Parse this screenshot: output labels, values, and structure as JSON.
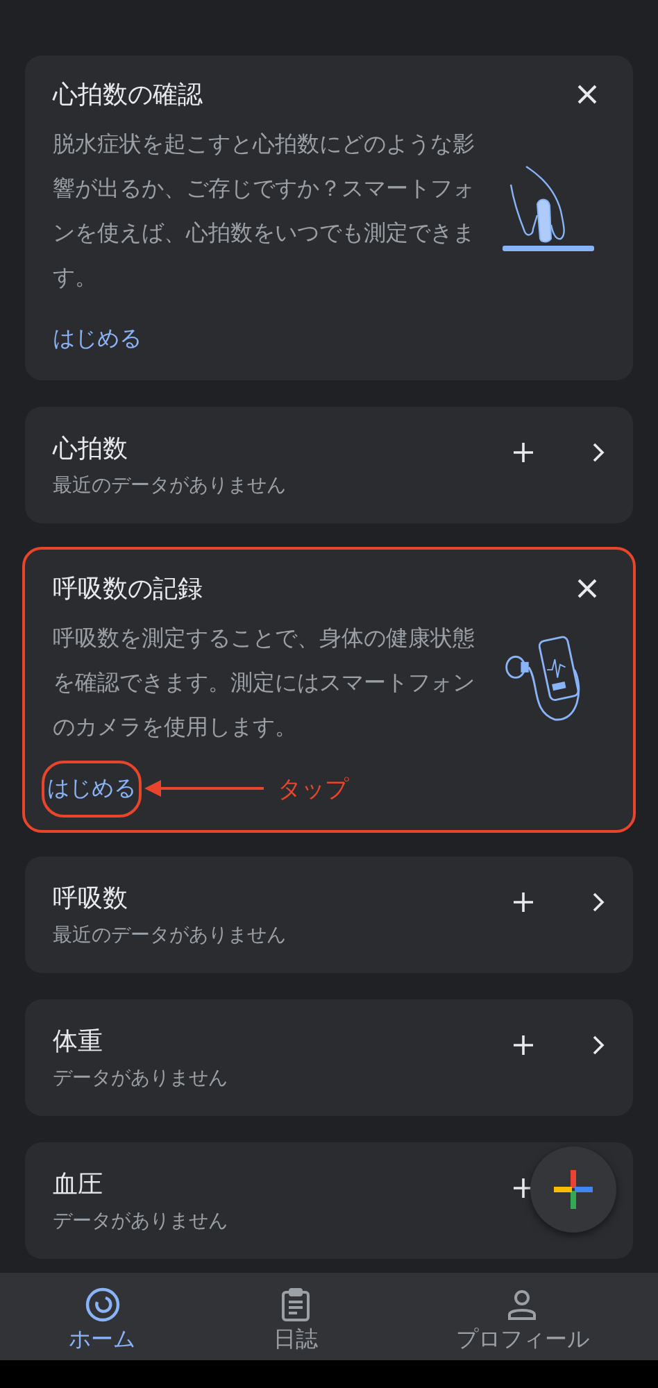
{
  "cards": [
    {
      "kind": "tip",
      "title": "心拍数の確認",
      "body": "脱水症状を起こすと心拍数にどのような影響が出るか、ご存じですか？スマートフォンを使えば、心拍数をいつでも測定できます。",
      "action": "はじめる",
      "annotated": false
    },
    {
      "kind": "metric",
      "title": "心拍数",
      "subtitle": "最近のデータがありません",
      "chevron": true
    },
    {
      "kind": "tip",
      "title": "呼吸数の記録",
      "body": "呼吸数を測定することで、身体の健康状態を確認できます。測定にはスマートフォンのカメラを使用します。",
      "action": "はじめる",
      "annotated": true,
      "annotation": "タップ"
    },
    {
      "kind": "metric",
      "title": "呼吸数",
      "subtitle": "最近のデータがありません",
      "chevron": true
    },
    {
      "kind": "metric",
      "title": "体重",
      "subtitle": "データがありません",
      "chevron": true
    },
    {
      "kind": "metric",
      "title": "血圧",
      "subtitle": "データがありません",
      "chevron": false
    }
  ],
  "nav": [
    {
      "label": "ホーム",
      "selected": true
    },
    {
      "label": "日誌",
      "selected": false
    },
    {
      "label": "プロフィール",
      "selected": false
    }
  ]
}
